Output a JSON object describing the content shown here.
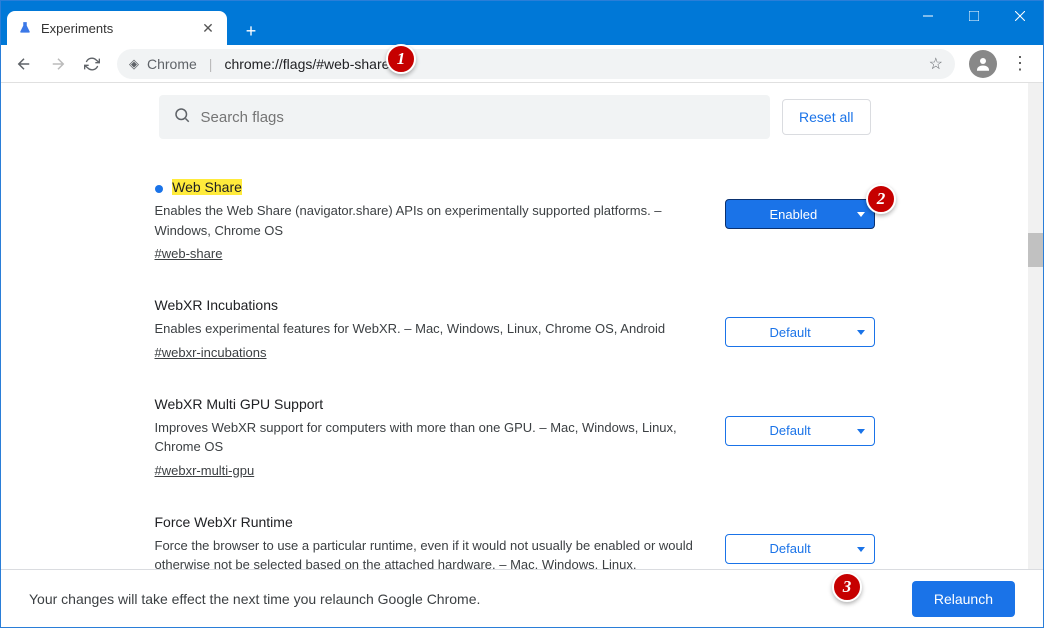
{
  "window": {
    "tab_title": "Experiments",
    "url_scheme": "Chrome",
    "url_rest": "chrome://flags/#web-share"
  },
  "search": {
    "placeholder": "Search flags"
  },
  "reset_label": "Reset all",
  "flags": [
    {
      "title": "Web Share",
      "desc": "Enables the Web Share (navigator.share) APIs on experimentally supported platforms. – Windows, Chrome OS",
      "hash": "#web-share",
      "value": "Enabled",
      "highlighted": true,
      "has_dot": true
    },
    {
      "title": "WebXR Incubations",
      "desc": "Enables experimental features for WebXR. – Mac, Windows, Linux, Chrome OS, Android",
      "hash": "#webxr-incubations",
      "value": "Default",
      "highlighted": false,
      "has_dot": false
    },
    {
      "title": "WebXR Multi GPU Support",
      "desc": "Improves WebXR support for computers with more than one GPU. – Mac, Windows, Linux, Chrome OS",
      "hash": "#webxr-multi-gpu",
      "value": "Default",
      "highlighted": false,
      "has_dot": false
    },
    {
      "title": "Force WebXr Runtime",
      "desc": "Force the browser to use a particular runtime, even if it would not usually be enabled or would otherwise not be selected based on the attached hardware. – Mac, Windows, Linux,",
      "hash": "",
      "value": "Default",
      "highlighted": false,
      "has_dot": false
    }
  ],
  "footer": {
    "text": "Your changes will take effect the next time you relaunch Google Chrome.",
    "relaunch": "Relaunch"
  },
  "annotations": {
    "a1": "1",
    "a2": "2",
    "a3": "3"
  }
}
